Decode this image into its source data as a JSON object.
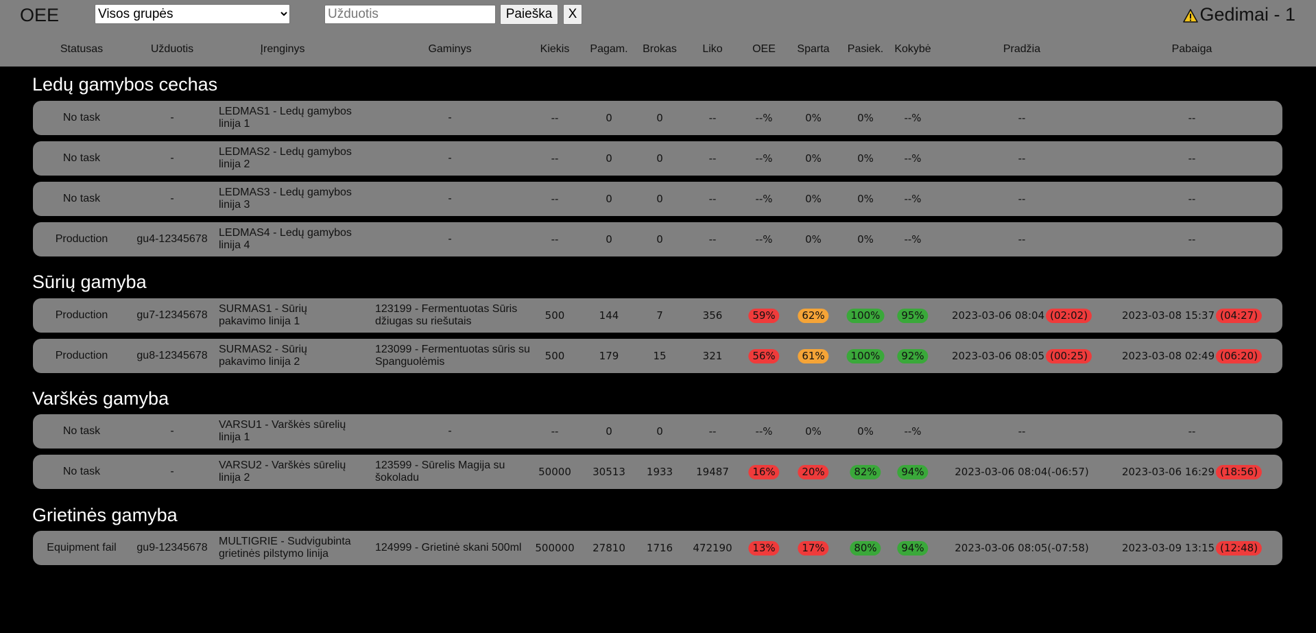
{
  "header": {
    "logo": "OEE",
    "group_select": {
      "selected": "Visos grupės"
    },
    "search": {
      "placeholder": "Užduotis",
      "value": ""
    },
    "search_button": "Paieška",
    "clear_button": "X",
    "alerts_label": "Gedimai - 1",
    "alert_icon": "warning-icon"
  },
  "columns": [
    "Statusas",
    "Užduotis",
    "Įrenginys",
    "Gaminys",
    "Kiekis",
    "Pagam.",
    "Brokas",
    "Liko",
    "OEE",
    "Sparta",
    "Pasiek.",
    "Kokybė",
    "Pradžia",
    "Pabaiga"
  ],
  "colors": {
    "red": "#ef3b3b",
    "orange": "#f5a437",
    "green": "#3aa83a"
  },
  "groups": [
    {
      "title": "Ledų gamybos cechas",
      "rows": [
        {
          "status": "No task",
          "task": "-",
          "device": "LEDMAS1 - Ledų gamybos linija 1",
          "product": "-",
          "qty": "--",
          "made": "0",
          "scrap": "0",
          "left": "--",
          "oee": "--%",
          "speed": "0%",
          "avail": "0%",
          "quality": "--%",
          "start": "--",
          "start_delta": "",
          "end": "--",
          "end_delta": ""
        },
        {
          "status": "No task",
          "task": "-",
          "device": "LEDMAS2 - Ledų gamybos linija 2",
          "product": "-",
          "qty": "--",
          "made": "0",
          "scrap": "0",
          "left": "--",
          "oee": "--%",
          "speed": "0%",
          "avail": "0%",
          "quality": "--%",
          "start": "--",
          "start_delta": "",
          "end": "--",
          "end_delta": ""
        },
        {
          "status": "No task",
          "task": "-",
          "device": "LEDMAS3 - Ledų gamybos linija 3",
          "product": "-",
          "qty": "--",
          "made": "0",
          "scrap": "0",
          "left": "--",
          "oee": "--%",
          "speed": "0%",
          "avail": "0%",
          "quality": "--%",
          "start": "--",
          "start_delta": "",
          "end": "--",
          "end_delta": ""
        },
        {
          "status": "Production",
          "task": "gu4-12345678",
          "device": "LEDMAS4 - Ledų gamybos linija 4",
          "product": "-",
          "qty": "--",
          "made": "0",
          "scrap": "0",
          "left": "--",
          "oee": "--%",
          "speed": "0%",
          "avail": "0%",
          "quality": "--%",
          "start": "--",
          "start_delta": "",
          "end": "--",
          "end_delta": ""
        }
      ]
    },
    {
      "title": "Sūrių gamyba",
      "rows": [
        {
          "status": "Production",
          "task": "gu7-12345678",
          "device": "SURMAS1 - Sūrių pakavimo linija 1",
          "product": "123199 - Fermentuotas Sūris džiugas su riešutais",
          "qty": "500",
          "made": "144",
          "scrap": "7",
          "left": "356",
          "oee": "59%",
          "oee_c": "red",
          "speed": "62%",
          "speed_c": "orange",
          "avail": "100%",
          "avail_c": "green",
          "quality": "95%",
          "quality_c": "green",
          "start": "2023-03-06 08:04",
          "start_delta": "(02:02)",
          "start_delta_c": "red",
          "end": "2023-03-08 15:37",
          "end_delta": "(04:27)",
          "end_delta_c": "red"
        },
        {
          "status": "Production",
          "task": "gu8-12345678",
          "device": "SURMAS2 - Sūrių pakavimo linija 2",
          "product": "123099 - Fermentuotas sūris su Spanguolėmis",
          "qty": "500",
          "made": "179",
          "scrap": "15",
          "left": "321",
          "oee": "56%",
          "oee_c": "red",
          "speed": "61%",
          "speed_c": "orange",
          "avail": "100%",
          "avail_c": "green",
          "quality": "92%",
          "quality_c": "green",
          "start": "2023-03-06 08:05",
          "start_delta": "(00:25)",
          "start_delta_c": "red",
          "end": "2023-03-08 02:49",
          "end_delta": "(06:20)",
          "end_delta_c": "red"
        }
      ]
    },
    {
      "title": "Varškės gamyba",
      "rows": [
        {
          "status": "No task",
          "task": "-",
          "device": "VARSU1 - Varškės sūrelių linija 1",
          "product": "-",
          "qty": "--",
          "made": "0",
          "scrap": "0",
          "left": "--",
          "oee": "--%",
          "speed": "0%",
          "avail": "0%",
          "quality": "--%",
          "start": "--",
          "start_delta": "",
          "end": "--",
          "end_delta": ""
        },
        {
          "status": "No task",
          "task": "-",
          "device": "VARSU2 - Varškės sūrelių linija 2",
          "product": "123599 - Sūrelis Magija su šokoladu",
          "qty": "50000",
          "made": "30513",
          "scrap": "1933",
          "left": "19487",
          "oee": "16%",
          "oee_c": "red",
          "speed": "20%",
          "speed_c": "red",
          "avail": "82%",
          "avail_c": "green",
          "quality": "94%",
          "quality_c": "green",
          "start": "2023-03-06 08:04",
          "start_delta": "(-06:57)",
          "end": "2023-03-06 16:29",
          "end_delta": "(18:56)",
          "end_delta_c": "red"
        }
      ]
    },
    {
      "title": "Grietinės gamyba",
      "rows": [
        {
          "status": "Equipment fail",
          "task": "gu9-12345678",
          "device": "MULTIGRIE - Sudvigubinta grietinės pilstymo linija",
          "product": "124999 - Grietinė skani 500ml",
          "qty": "500000",
          "made": "27810",
          "scrap": "1716",
          "left": "472190",
          "oee": "13%",
          "oee_c": "red",
          "speed": "17%",
          "speed_c": "red",
          "avail": "80%",
          "avail_c": "green",
          "quality": "94%",
          "quality_c": "green",
          "start": "2023-03-06 08:05",
          "start_delta": "(-07:58)",
          "end": "2023-03-09 13:15",
          "end_delta": "(12:48)",
          "end_delta_c": "red"
        }
      ]
    }
  ]
}
